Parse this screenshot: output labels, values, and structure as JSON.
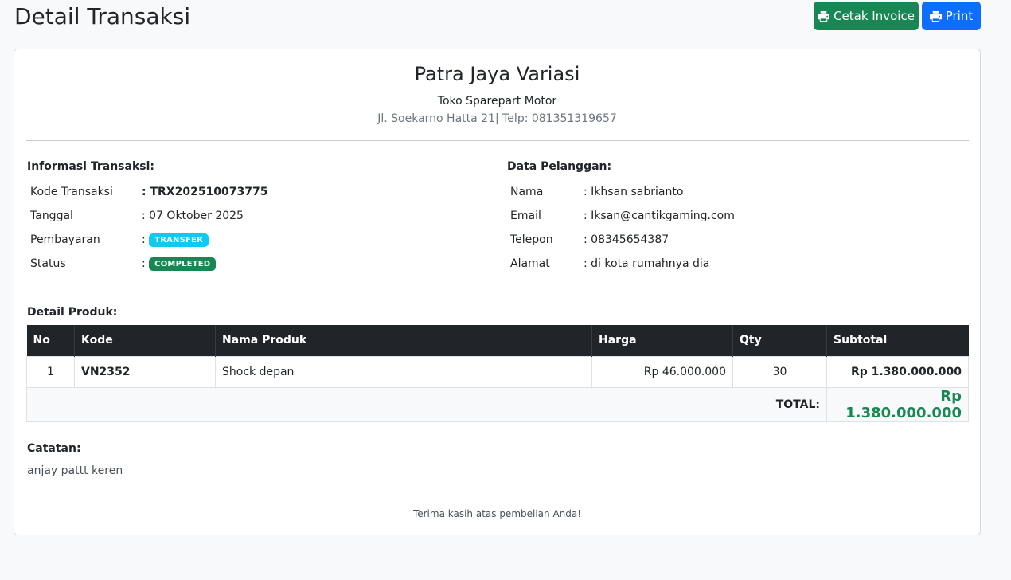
{
  "page": {
    "title": "Detail Transaksi"
  },
  "toolbar": {
    "invoice_label": "Cetak Invoice",
    "print_label": "Print"
  },
  "store": {
    "name": "Patra Jaya Variasi",
    "type": "Toko Sparepart Motor",
    "address": "Jl. Soekarno Hatta 21| Telp: 081351319657"
  },
  "transaction": {
    "title": "Informasi Transaksi:",
    "fields": [
      {
        "label": "Kode Transaksi",
        "value": ": TRX202510073775"
      },
      {
        "label": "Tanggal",
        "value": ": 07 Oktober 2025"
      },
      {
        "label": "Pembayaran",
        "value": ":",
        "badge": "TRANSFER"
      },
      {
        "label": "Status",
        "value": ":",
        "badge": "COMPLETED"
      }
    ]
  },
  "customer": {
    "title": "Data Pelanggan:",
    "fields": [
      {
        "label": "Nama",
        "value": ": Ikhsan sabrianto"
      },
      {
        "label": "Email",
        "value": ": Iksan@cantikgaming.com"
      },
      {
        "label": "Telepon",
        "value": ": 08345654387"
      },
      {
        "label": "Alamat",
        "value": ": di kota rumahnya dia"
      }
    ]
  },
  "products": {
    "title": "Detail Produk:",
    "columns": [
      "No",
      "Kode",
      "Nama Produk",
      "Harga",
      "Qty",
      "Subtotal"
    ],
    "rows": [
      {
        "no": "1",
        "kode": "VN2352",
        "nama": "Shock depan",
        "harga": "Rp 46.000.000",
        "qty": "30",
        "subtotal": "Rp 1.380.000.000"
      }
    ],
    "total_label": "TOTAL:",
    "total_value": "Rp 1.380.000.000"
  },
  "notes": {
    "title": "Catatan:",
    "text": "anjay pattt keren"
  },
  "footer": {
    "thanks": "Terima kasih atas pembelian Anda!"
  },
  "colors": {
    "success": "#198754",
    "primary": "#0d6efd",
    "info": "#0dcaf0",
    "dark": "#212529"
  },
  "icons": {
    "print": "printer-icon"
  }
}
